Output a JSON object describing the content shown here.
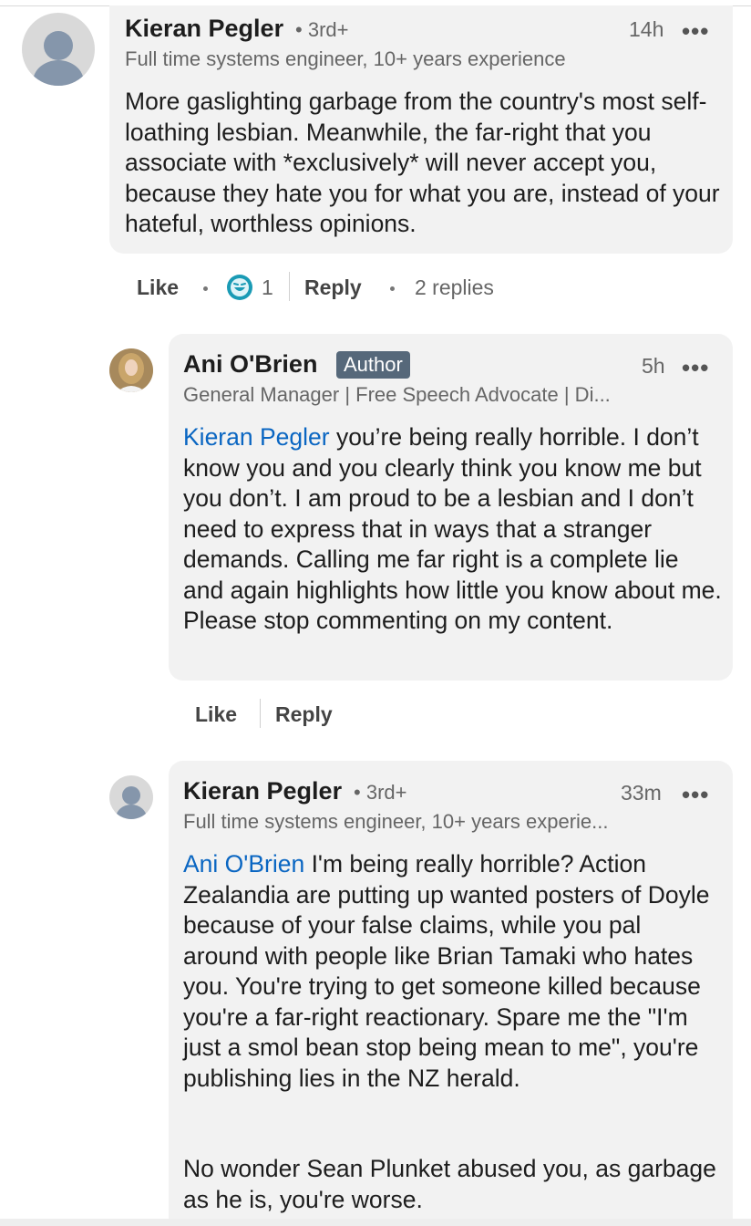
{
  "comments": [
    {
      "author": "Kieran Pegler",
      "degree": "3rd+",
      "headline": "Full time systems engineer, 10+ years experience",
      "time": "14h",
      "body": "More gaslighting garbage from the country's most self-loathing lesbian. Meanwhile, the far-right that you associate with *exclusively* will never accept you, because they hate you for what you are, instead of your hateful, worthless opinions.",
      "actions": {
        "like": "Like",
        "reaction_count": "1",
        "reply": "Reply",
        "replies": "2 replies"
      }
    },
    {
      "author": "Ani O'Brien",
      "badge": "Author",
      "headline": "General Manager | Free Speech Advocate | Di...",
      "time": "5h",
      "mention": "Kieran Pegler",
      "body": " you’re being really horrible. I don’t know you and you clearly think you know me but you don’t. I am proud to be a lesbian and I don’t need to express that in ways that a stranger demands. Calling me far right is a complete lie and again highlights how little you know about me. Please stop commenting on my content.",
      "actions": {
        "like": "Like",
        "reply": "Reply"
      }
    },
    {
      "author": "Kieran Pegler",
      "degree": "3rd+",
      "headline": "Full time systems engineer, 10+ years experie...",
      "time": "33m",
      "mention": "Ani O'Brien",
      "body": " I'm being really horrible? Action Zealandia are putting up wanted posters of Doyle because of your false claims, while you pal around with people like Brian Tamaki who hates you. You're trying to get someone killed because you're a far-right reactionary. Spare me the \"I'm just a smol bean stop being mean to me\", you're publishing lies in the NZ herald.",
      "body2": "No wonder Sean Plunket abused you, as garbage as he is, you're worse."
    }
  ],
  "icons": {
    "more": "more-options-icon",
    "reaction": "laugh-reaction-icon",
    "avatar": "default-avatar-icon"
  },
  "colors": {
    "link": "#0a66c2",
    "bubble": "#f2f2f2",
    "badge": "#56687a",
    "reaction": "#1a9bb5"
  },
  "glyphs": {
    "dots": "•••",
    "sep": "•"
  }
}
